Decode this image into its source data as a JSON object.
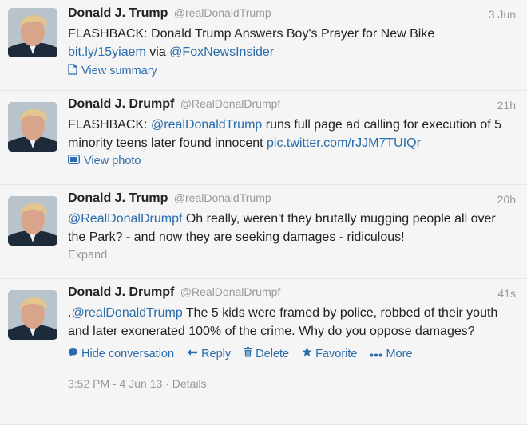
{
  "tweets": [
    {
      "fullname": "Donald J. Trump",
      "handle": "@realDonaldTrump",
      "time": "3 Jun",
      "text_parts": [
        "FLASHBACK: Donald Trump Answers Boy's Prayer for New Bike",
        "bit.ly/15yiaem",
        " via ",
        "@FoxNewsInsider"
      ],
      "action": "View summary",
      "action_icon": "document-icon"
    },
    {
      "fullname": "Donald J. Drumpf",
      "handle": "@RealDonalDrumpf",
      "time": "21h",
      "text_parts": [
        "FLASHBACK: ",
        "@realDonaldTrump",
        " runs full page ad calling for execution of 5 minority teens later found innocent ",
        "pic.twitter.com/rJJM7TUIQr"
      ],
      "action": "View photo",
      "action_icon": "photo-icon"
    },
    {
      "fullname": "Donald J. Trump",
      "handle": "@realDonaldTrump",
      "time": "20h",
      "text_parts": [
        "@RealDonalDrumpf",
        "  Oh really, weren't they brutally mugging people all over the Park? - and now they are seeking damages - ridiculous!"
      ],
      "action": "Expand"
    },
    {
      "fullname": "Donald J. Drumpf",
      "handle": "@RealDonalDrumpf",
      "time": "41s",
      "text_parts": [
        ".",
        "@realDonaldTrump",
        " The 5 kids were framed by police, robbed of their youth and later exonerated 100% of the crime. Why do you oppose damages?"
      ],
      "actions": {
        "hide": "Hide conversation",
        "reply": "Reply",
        "delete": "Delete",
        "favorite": "Favorite",
        "more": "More"
      },
      "timestamp": "3:52 PM - 4 Jun 13",
      "separator": " · ",
      "details": "Details"
    }
  ],
  "colors": {
    "link": "#2a6cab",
    "muted": "#999999",
    "background": "#f5f5f5"
  }
}
